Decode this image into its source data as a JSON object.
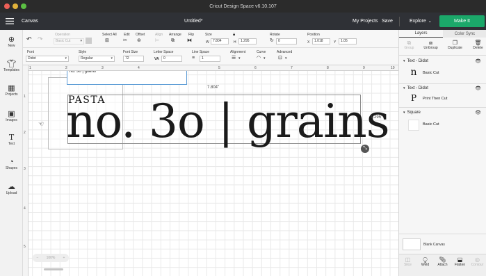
{
  "window": {
    "title": "Cricut Design Space  v6.10.107"
  },
  "header": {
    "menu_icon": "hamburger-icon",
    "section": "Canvas",
    "doc_title": "Untitled*",
    "my_projects": "My Projects",
    "save": "Save",
    "explore": "Explore",
    "make_it": "Make It",
    "accent_color": "#1ba86a"
  },
  "toolbar1": {
    "undo_icon": "undo-icon",
    "redo_icon": "redo-icon",
    "operation_label": "Operation",
    "operation_value": "Basic Cut",
    "select_all": "Select All",
    "edit": "Edit",
    "offset": "Offset",
    "align": "Align",
    "arrange": "Arrange",
    "flip": "Flip",
    "size": "Size",
    "w_label": "W",
    "w_value": "7.804",
    "h_label": "H",
    "h_value": "1.295",
    "rotate": "Rotate",
    "rotate_value": "0",
    "position": "Position",
    "x_label": "X",
    "x_value": "1.018",
    "y_label": "Y",
    "y_value": "1.05"
  },
  "toolbar2": {
    "font_label": "Font",
    "font_value": "Didot",
    "style_label": "Style",
    "style_value": "Regular",
    "font_size_label": "Font Size",
    "font_size_value": "72",
    "letter_space_label": "Letter Space",
    "letter_space_prefix": "VA",
    "letter_space_value": "0",
    "line_space_label": "Line Space",
    "line_space_value": "1",
    "alignment_label": "Alignment",
    "curve_label": "Curve",
    "advanced_label": "Advanced"
  },
  "sidebar": {
    "items": [
      {
        "label": "New",
        "icon": "plus-circle-icon"
      },
      {
        "label": "Templates",
        "icon": "shirt-icon"
      },
      {
        "label": "Projects",
        "icon": "projects-icon"
      },
      {
        "label": "Images",
        "icon": "image-icon"
      },
      {
        "label": "Text",
        "icon": "text-icon"
      },
      {
        "label": "Shapes",
        "icon": "shapes-icon"
      },
      {
        "label": "Upload",
        "icon": "upload-icon"
      }
    ]
  },
  "canvas": {
    "ruler_top": [
      "1",
      "2",
      "3",
      "4",
      "5",
      "6",
      "7",
      "8",
      "9",
      "10"
    ],
    "ruler_left": [
      "1",
      "2",
      "3",
      "4",
      "5"
    ],
    "text_edit_value": "no. 30 | grains",
    "pasta_text": "PASTA",
    "main_text": "no. 3o | grains",
    "width_dim": "7.804\"",
    "height_dim": "1.295\"",
    "zoom_value": "100%"
  },
  "rightpanel": {
    "tabs": [
      "Layers",
      "Color Sync"
    ],
    "top_buttons": [
      "Group",
      "UnGroup",
      "Duplicate",
      "Delete"
    ],
    "layers": [
      {
        "title": "Text - Didot",
        "thumb": "n",
        "op": "Basic Cut"
      },
      {
        "title": "Text - Didot",
        "thumb": "P",
        "op": "Print Then Cut"
      },
      {
        "title": "Square",
        "thumb": "",
        "op": "Basic Cut"
      }
    ],
    "blank_canvas": "Blank Canvas",
    "bottom_buttons": [
      "Slice",
      "Weld",
      "Attach",
      "Flatten",
      "Contour"
    ]
  }
}
